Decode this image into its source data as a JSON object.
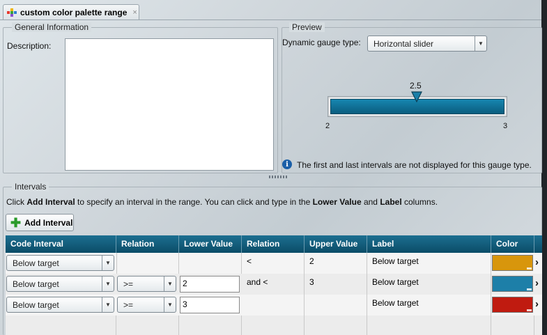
{
  "tab": {
    "title": "custom color palette range",
    "close": "×"
  },
  "general": {
    "legend": "General Information",
    "description_label": "Description:",
    "description_value": ""
  },
  "preview": {
    "legend": "Preview",
    "gauge_type_label": "Dynamic gauge type:",
    "gauge_type_value": "Horizontal slider",
    "slider": {
      "value_label": "2.5",
      "min_label": "2",
      "max_label": "3",
      "value": 2.5,
      "min": 2,
      "max": 3
    },
    "info_text": "The first and last intervals are not displayed for this gauge type."
  },
  "intervals": {
    "legend": "Intervals",
    "instruction": {
      "p1": "Click ",
      "b1": "Add Interval",
      "p2": " to specify an interval in the range. You can click and type in the ",
      "b2": "Lower Value",
      "p3": " and ",
      "b3": "Label",
      "p4": " columns."
    },
    "add_button": "Add Interval",
    "columns": [
      "Code Interval",
      "Relation",
      "Lower Value",
      "Relation",
      "Upper Value",
      "Label",
      "Color"
    ],
    "rows": [
      {
        "code": "Below target",
        "relation1": "",
        "lower": "",
        "relation2": "<",
        "upper": "2",
        "label": "Below target",
        "color": "#d8960c"
      },
      {
        "code": "Below target",
        "relation1": ">=",
        "lower": "2",
        "relation2": "and <",
        "upper": "3",
        "label": "Below target",
        "color": "#1d7fa8"
      },
      {
        "code": "Below target",
        "relation1": ">=",
        "lower": "3",
        "relation2": "",
        "upper": "",
        "label": "Below target",
        "color": "#c01b10"
      }
    ]
  },
  "icons": {
    "tab": "palette-icon",
    "info": "info-icon",
    "add": "plus-icon",
    "row_more": "chevron-right-icon"
  },
  "colors": {
    "header": "#0f5a78",
    "slider_fill": "#0e6f94"
  }
}
